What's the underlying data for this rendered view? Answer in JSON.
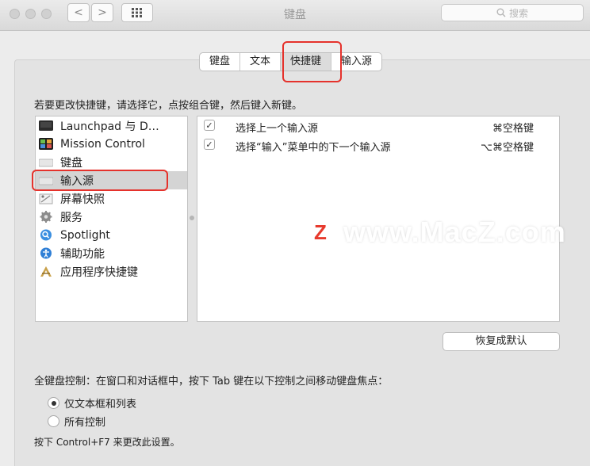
{
  "window": {
    "title": "键盘",
    "back_label": "<",
    "forward_label": ">",
    "search_placeholder": "搜索"
  },
  "tabs": [
    {
      "label": "键盘",
      "active": false
    },
    {
      "label": "文本",
      "active": false
    },
    {
      "label": "快捷键",
      "active": true
    },
    {
      "label": "输入源",
      "active": false
    }
  ],
  "instruction": "若要更改快捷键，请选择它，点按组合键，然后键入新键。",
  "categories": [
    {
      "label": "Launchpad 与 D…",
      "icon": "launchpad-icon",
      "selected": false
    },
    {
      "label": "Mission Control",
      "icon": "mission-control-icon",
      "selected": false
    },
    {
      "label": "键盘",
      "icon": "keyboard-icon",
      "selected": false
    },
    {
      "label": "输入源",
      "icon": "input-source-icon",
      "selected": true
    },
    {
      "label": "屏幕快照",
      "icon": "screenshot-icon",
      "selected": false
    },
    {
      "label": "服务",
      "icon": "gear-icon",
      "selected": false
    },
    {
      "label": "Spotlight",
      "icon": "spotlight-icon",
      "selected": false
    },
    {
      "label": "辅助功能",
      "icon": "accessibility-icon",
      "selected": false
    },
    {
      "label": "应用程序快捷键",
      "icon": "app-shortcut-icon",
      "selected": false
    }
  ],
  "shortcuts": [
    {
      "checked": true,
      "description": "选择上一个输入源",
      "keys": "⌘空格键"
    },
    {
      "checked": true,
      "description": "选择“输入”菜单中的下一个输入源",
      "keys": "⌥⌘空格键"
    }
  ],
  "restore_defaults": "恢复成默认",
  "full_keyboard": {
    "label": "全键盘控制：在窗口和对话框中，按下 Tab 键在以下控制之间移动键盘焦点：",
    "options": [
      {
        "label": "仅文本框和列表",
        "selected": true
      },
      {
        "label": "所有控制",
        "selected": false
      }
    ],
    "hint": "按下 Control+F7 来更改此设置。"
  },
  "watermark": {
    "logo_letter": "Z",
    "text": "www.MacZ.com"
  },
  "colors": {
    "highlight": "#e5322c",
    "selection": "#d4d4d4"
  }
}
